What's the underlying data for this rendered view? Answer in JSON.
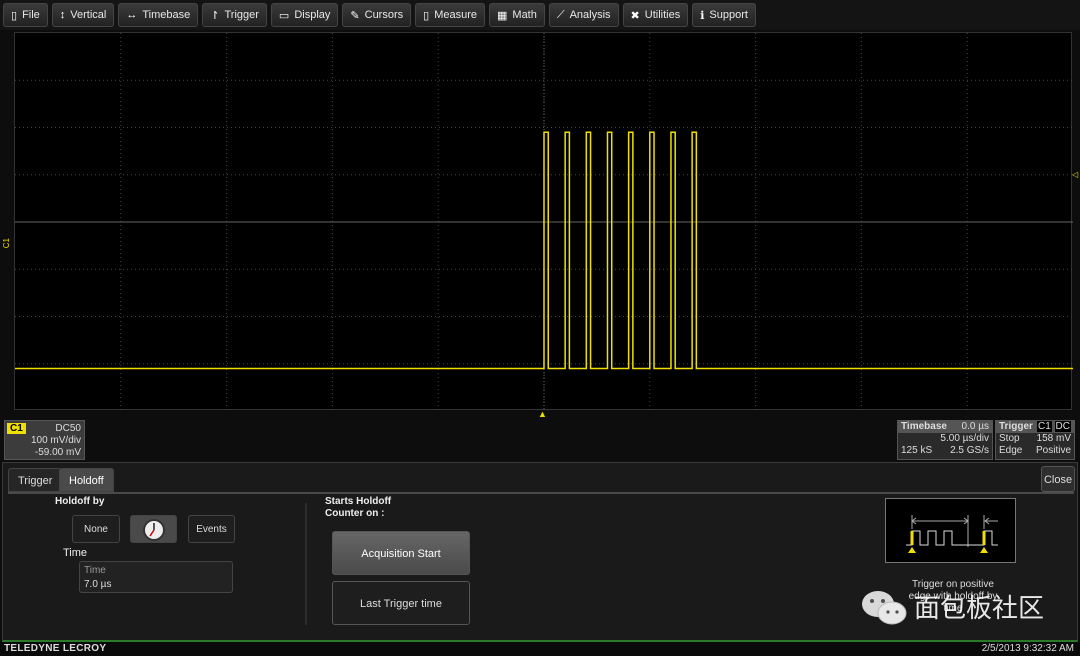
{
  "menu": [
    {
      "label": "File",
      "icon": "file-icon",
      "glyph": "▯"
    },
    {
      "label": "Vertical",
      "icon": "vertical-arrows-icon",
      "glyph": "↕"
    },
    {
      "label": "Timebase",
      "icon": "horizontal-arrows-icon",
      "glyph": "↔"
    },
    {
      "label": "Trigger",
      "icon": "trigger-flag-icon",
      "glyph": "↾"
    },
    {
      "label": "Display",
      "icon": "display-icon",
      "glyph": "▭"
    },
    {
      "label": "Cursors",
      "icon": "cursor-icon",
      "glyph": "✎"
    },
    {
      "label": "Measure",
      "icon": "measure-icon",
      "glyph": "▯"
    },
    {
      "label": "Math",
      "icon": "calculator-icon",
      "glyph": "▦"
    },
    {
      "label": "Analysis",
      "icon": "chart-icon",
      "glyph": "⟋"
    },
    {
      "label": "Utilities",
      "icon": "tools-icon",
      "glyph": "✖"
    },
    {
      "label": "Support",
      "icon": "info-icon",
      "glyph": "ℹ"
    }
  ],
  "trace": {
    "color": "#f0e000",
    "low_div": -3.1,
    "high_div": 1.9,
    "pulse_starts_us": [
      0,
      1,
      2,
      3,
      4,
      5,
      6,
      7
    ],
    "pulse_width_us": 0.2,
    "us_per_div": 5,
    "h_divs": 10,
    "v_divs": 8,
    "channel_marker": "C1"
  },
  "channel": {
    "name": "C1",
    "coupling": "DC50",
    "scale": "100 mV/div",
    "offset": "-59.00 mV"
  },
  "timebase": {
    "title": "Timebase",
    "delay": "0.0 µs",
    "scale": "5.00 µs/div",
    "samples": "125 kS",
    "rate": "2.5 GS/s"
  },
  "trigger": {
    "title": "Trigger",
    "source": "C1",
    "coupling": "DC",
    "mode": "Stop",
    "level": "158 mV",
    "type": "Edge",
    "slope": "Positive"
  },
  "panel": {
    "tabs": [
      "Trigger",
      "Holdoff"
    ],
    "close": "Close",
    "holdoff_by": "Holdoff by",
    "options": {
      "none": "None",
      "events": "Events"
    },
    "time_label": "Time",
    "time_field_label": "Time",
    "time_value": "7.0 µs",
    "starts_label": "Starts Holdoff Counter on :",
    "acq_start": "Acquisition Start",
    "last_trigger": "Last Trigger time",
    "diagram_text": "Trigger on positive edge with holdoff by time"
  },
  "watermark": "面包板社区",
  "footer": {
    "brand": "TELEDYNE LECROY",
    "datetime": "2/5/2013 9:32:32 AM"
  }
}
